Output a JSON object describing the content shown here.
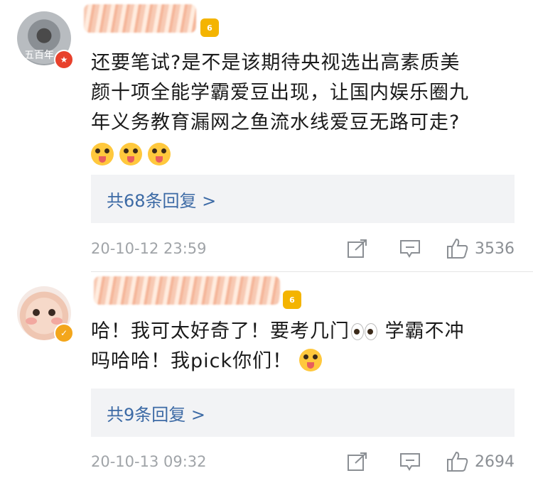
{
  "comments": [
    {
      "avatar_text": "五百年",
      "body": [
        "还要笔试?是不是该期待央视选出高素质美",
        "颜十项全能学霸爱豆出现，让国内娱乐圈九",
        "年义务教育漏网之鱼流水线爱豆无路可走?"
      ],
      "reply_label": "共68条回复 >",
      "time": "20-10-12 23:59",
      "likes": "3536",
      "level": "6"
    },
    {
      "body_line1_a": "哈！我可太好奇了！要考几门",
      "body_line1_b": " 学霸不冲",
      "body_line2": "吗哈哈！我pick你们！",
      "reply_label": "共9条回复 >",
      "time": "20-10-13 09:32",
      "likes": "2694",
      "level": "6"
    }
  ]
}
